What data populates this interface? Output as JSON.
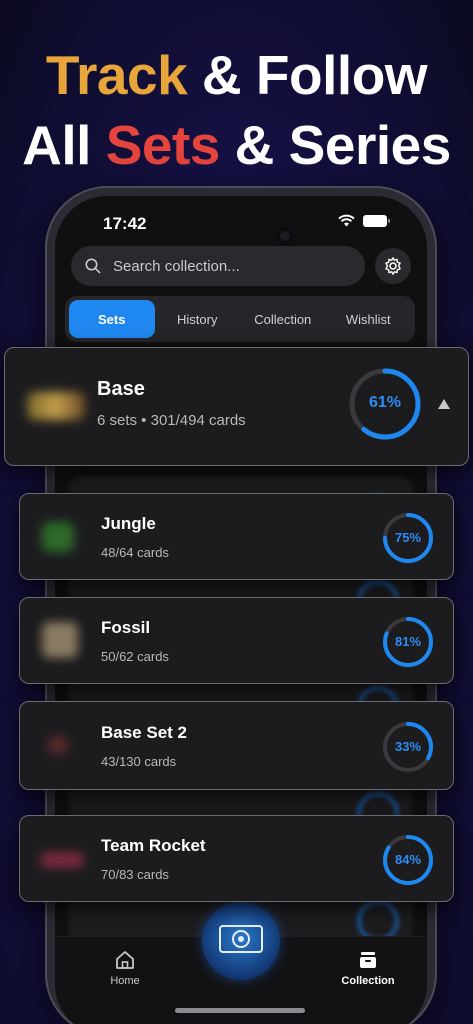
{
  "headline": {
    "line1_a": "Track",
    "line1_b": " & Follow",
    "line2_a": "All ",
    "line2_b": "Sets",
    "line2_c": " & Series"
  },
  "status": {
    "time": "17:42"
  },
  "search": {
    "placeholder": "Search collection..."
  },
  "tabs": [
    {
      "label": "Sets",
      "active": true
    },
    {
      "label": "History",
      "active": false
    },
    {
      "label": "Collection",
      "active": false
    },
    {
      "label": "Wishlist",
      "active": false
    }
  ],
  "series": {
    "title": "Base",
    "subtitle": "6 sets • 301/494 cards",
    "percent_label": "61%",
    "progress": 0.61
  },
  "sets": [
    {
      "title": "Jungle",
      "subtitle": "48/64 cards",
      "percent_label": "75%",
      "progress": 0.75
    },
    {
      "title": "Fossil",
      "subtitle": "50/62 cards",
      "percent_label": "81%",
      "progress": 0.81
    },
    {
      "title": "Base Set 2",
      "subtitle": "43/130 cards",
      "percent_label": "33%",
      "progress": 0.33
    },
    {
      "title": "Team Rocket",
      "subtitle": "70/83 cards",
      "percent_label": "84%",
      "progress": 0.84
    }
  ],
  "nav": {
    "home": "Home",
    "collection": "Collection"
  },
  "colors": {
    "accent": "#1e87f0",
    "gold": "#e8a63a",
    "red": "#e5453d"
  },
  "icons": [
    "search-icon",
    "gear-icon",
    "chevron-up-icon",
    "home-icon",
    "collection-icon",
    "camera-scan-icon",
    "wifi-icon",
    "battery-icon"
  ]
}
